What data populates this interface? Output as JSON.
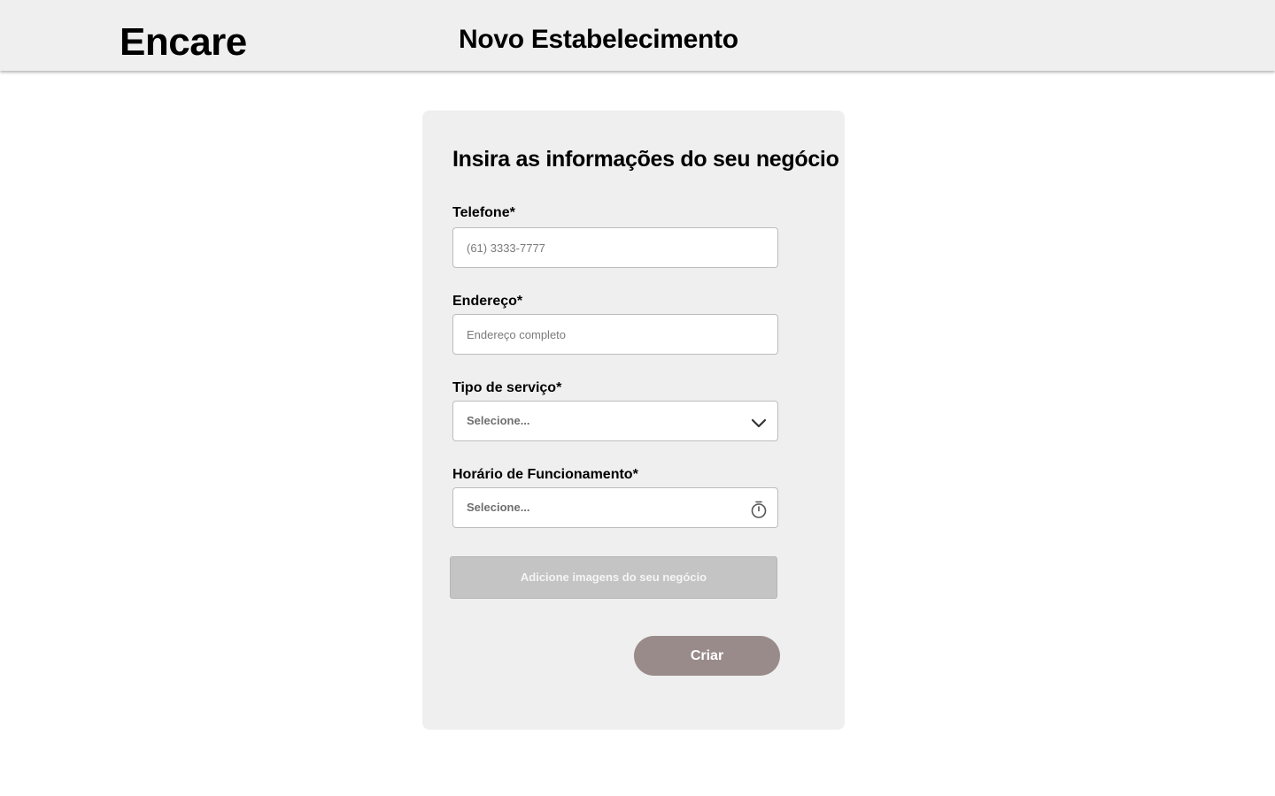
{
  "header": {
    "brand": "Encare",
    "title": "Novo Estabelecimento",
    "background_color": "#efefef"
  },
  "form": {
    "heading": "Insira as informações do seu negócio",
    "background_color": "#efefef",
    "fields": [
      {
        "label": "Telefone*",
        "type": "text",
        "placeholder": "(61) 3333-7777",
        "value": ""
      },
      {
        "label": "Endereço*",
        "type": "text",
        "placeholder": "Endereço completo",
        "value": ""
      },
      {
        "label": "Tipo de serviço*",
        "type": "select",
        "selected": "Selecione...",
        "icon": "chevron-down-icon"
      },
      {
        "label": "Horário de Funcionamento*",
        "type": "select",
        "selected": "Selecione...",
        "icon": "stopwatch-icon"
      }
    ],
    "upload_label": "Adicione imagens do seu negócio",
    "upload_color": "#c4c4c4",
    "submit_label": "Criar",
    "submit_color": "#9a8b8b"
  }
}
